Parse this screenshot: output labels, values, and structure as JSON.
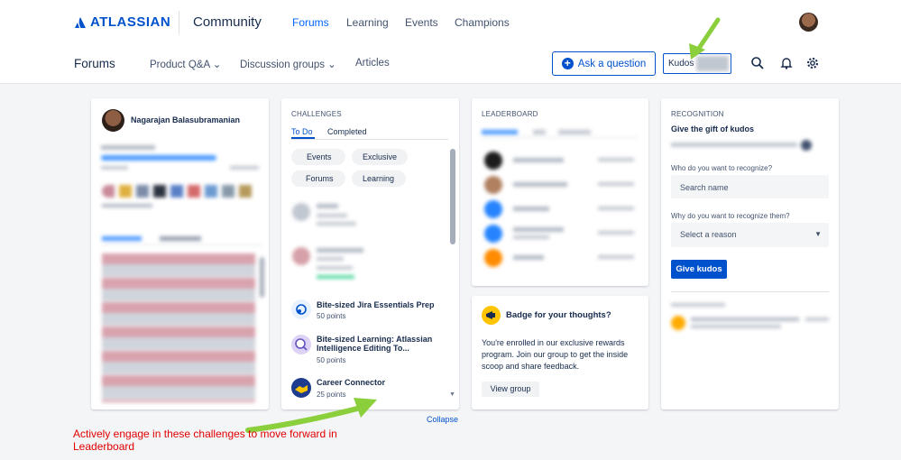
{
  "header": {
    "brand": "ATLASSIAN",
    "product": "Community",
    "nav": [
      {
        "label": "Forums",
        "active": true
      },
      {
        "label": "Learning",
        "active": false
      },
      {
        "label": "Events",
        "active": false
      },
      {
        "label": "Champions",
        "active": false
      }
    ]
  },
  "subheader": {
    "title": "Forums",
    "nav": [
      "Product Q&A",
      "Discussion groups",
      "Articles"
    ],
    "ask_button": "Ask a question",
    "kudos_label": "Kudos"
  },
  "profile": {
    "name": "Nagarajan Balasubramanian"
  },
  "challenges": {
    "heading": "CHALLENGES",
    "tabs": [
      "To Do",
      "Completed"
    ],
    "filters": [
      "Events",
      "Exclusive",
      "Forums",
      "Learning"
    ],
    "items": [
      {
        "title": "Bite-sized Jira Essentials Prep",
        "points": "50  points"
      },
      {
        "title": "Bite-sized Learning: Atlassian Intelligence Editing To...",
        "points": "50  points"
      },
      {
        "title": "Career Connector",
        "points": "25  points"
      }
    ],
    "collapse_label": "Collapse"
  },
  "leaderboard": {
    "heading": "LEADERBOARD"
  },
  "badge_card": {
    "title": "Badge for your thoughts?",
    "body": "You're enrolled in our exclusive rewards program. Join our group to get the inside scoop and share feedback.",
    "button": "View group"
  },
  "recognition": {
    "heading": "RECOGNITION",
    "subtitle": "Give the gift of kudos",
    "who_label": "Who do you want to recognize?",
    "search_placeholder": "Search name",
    "why_label": "Why do you want to recognize them?",
    "reason_placeholder": "Select a reason",
    "button": "Give kudos"
  },
  "annotation": "Actively engage in these challenges to move forward in Leaderboard",
  "colors": {
    "accent": "#0052cc",
    "active_nav": "#0065ff",
    "annotation": "#e00000",
    "arrow": "#8ccf3c"
  }
}
